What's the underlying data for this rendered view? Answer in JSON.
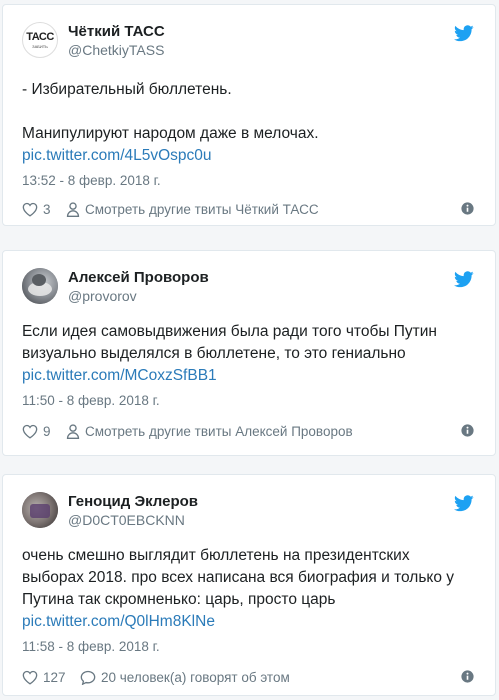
{
  "tweets": [
    {
      "name": "Чёткий ТАСС",
      "handle": "@ChetkiyTASS",
      "avatar_text": "ТАСС",
      "avatar_sub": "ЗАБИТЬ",
      "text_lines": [
        "- Избирательный бюллетень."
      ],
      "text_lines_2": [
        "Манипулируют народом даже в мелочах."
      ],
      "link": "pic.twitter.com/4L5vOspc0u",
      "timestamp": "13:52 - 8 февр. 2018 г.",
      "likes": "3",
      "secondary": "Смотреть другие твиты Чёткий ТАСС"
    },
    {
      "name": "Алексей Проворов",
      "handle": "@provorov",
      "text_lines": [
        "Если идея самовыдвижения была ради того чтобы Путин",
        "визуально выделялся в бюллетене, то это гениально"
      ],
      "link": "pic.twitter.com/MCoxzSfBB1",
      "timestamp": "11:50 - 8 февр. 2018 г.",
      "likes": "9",
      "secondary": "Смотреть другие твиты Алексей Проворов"
    },
    {
      "name": "Геноцид Эклеров",
      "handle": "@D0CT0EBCKNN",
      "text_lines": [
        "очень смешно выглядит бюллетень на президентских",
        "выборах 2018. про всех написана вся биография и только у",
        "Путина так скромненько: царь, просто царь"
      ],
      "link": "pic.twitter.com/Q0lHm8KlNe",
      "timestamp": "11:58 - 8 февр. 2018 г.",
      "likes": "127",
      "secondary": "20 человек(а) говорят об этом"
    }
  ],
  "colors": {
    "link": "#2b7bb9",
    "twitter_blue": "#1da1f2",
    "muted": "#697882",
    "text": "#1c2022",
    "border": "#e1e8ed"
  }
}
